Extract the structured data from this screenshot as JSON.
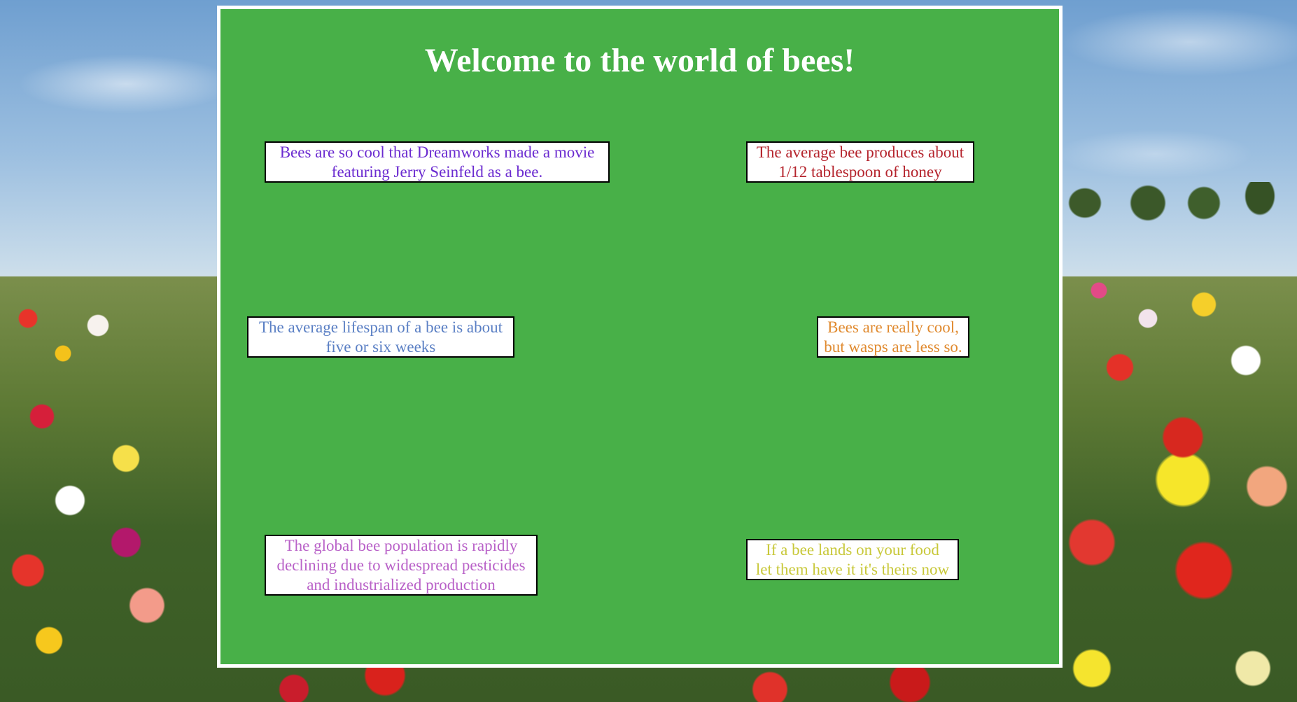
{
  "page": {
    "title": "Welcome to the world of bees!"
  },
  "facts": [
    {
      "text_lines": [
        "Bees are so cool that Dreamworks made a movie",
        "featuring Jerry Seinfeld as a bee."
      ],
      "color": "#6b2bd0"
    },
    {
      "text_lines": [
        "The average bee produces about",
        "1/12 tablespoon of honey"
      ],
      "color": "#b5242d"
    },
    {
      "text_lines": [
        "The average lifespan of a bee is about",
        "five or six weeks"
      ],
      "color": "#5a7fc4"
    },
    {
      "text_lines": [
        "Bees are really cool,",
        "but wasps are less so."
      ],
      "color": "#e08a2f"
    },
    {
      "text_lines": [
        "The global bee population is rapidly",
        "declining due to widespread pesticides",
        "and industrialized production"
      ],
      "color": "#b962c8"
    },
    {
      "text_lines": [
        "If a bee lands on your food",
        "let them have it it's theirs now"
      ],
      "color": "#c8c83a"
    }
  ],
  "colors": {
    "panel_background": "#48b048",
    "panel_border": "#ffffff",
    "title_color": "#ffffff",
    "fact_box_background": "#ffffff",
    "fact_box_border": "#000000"
  },
  "background": {
    "description_icon": "flower-field-background"
  }
}
